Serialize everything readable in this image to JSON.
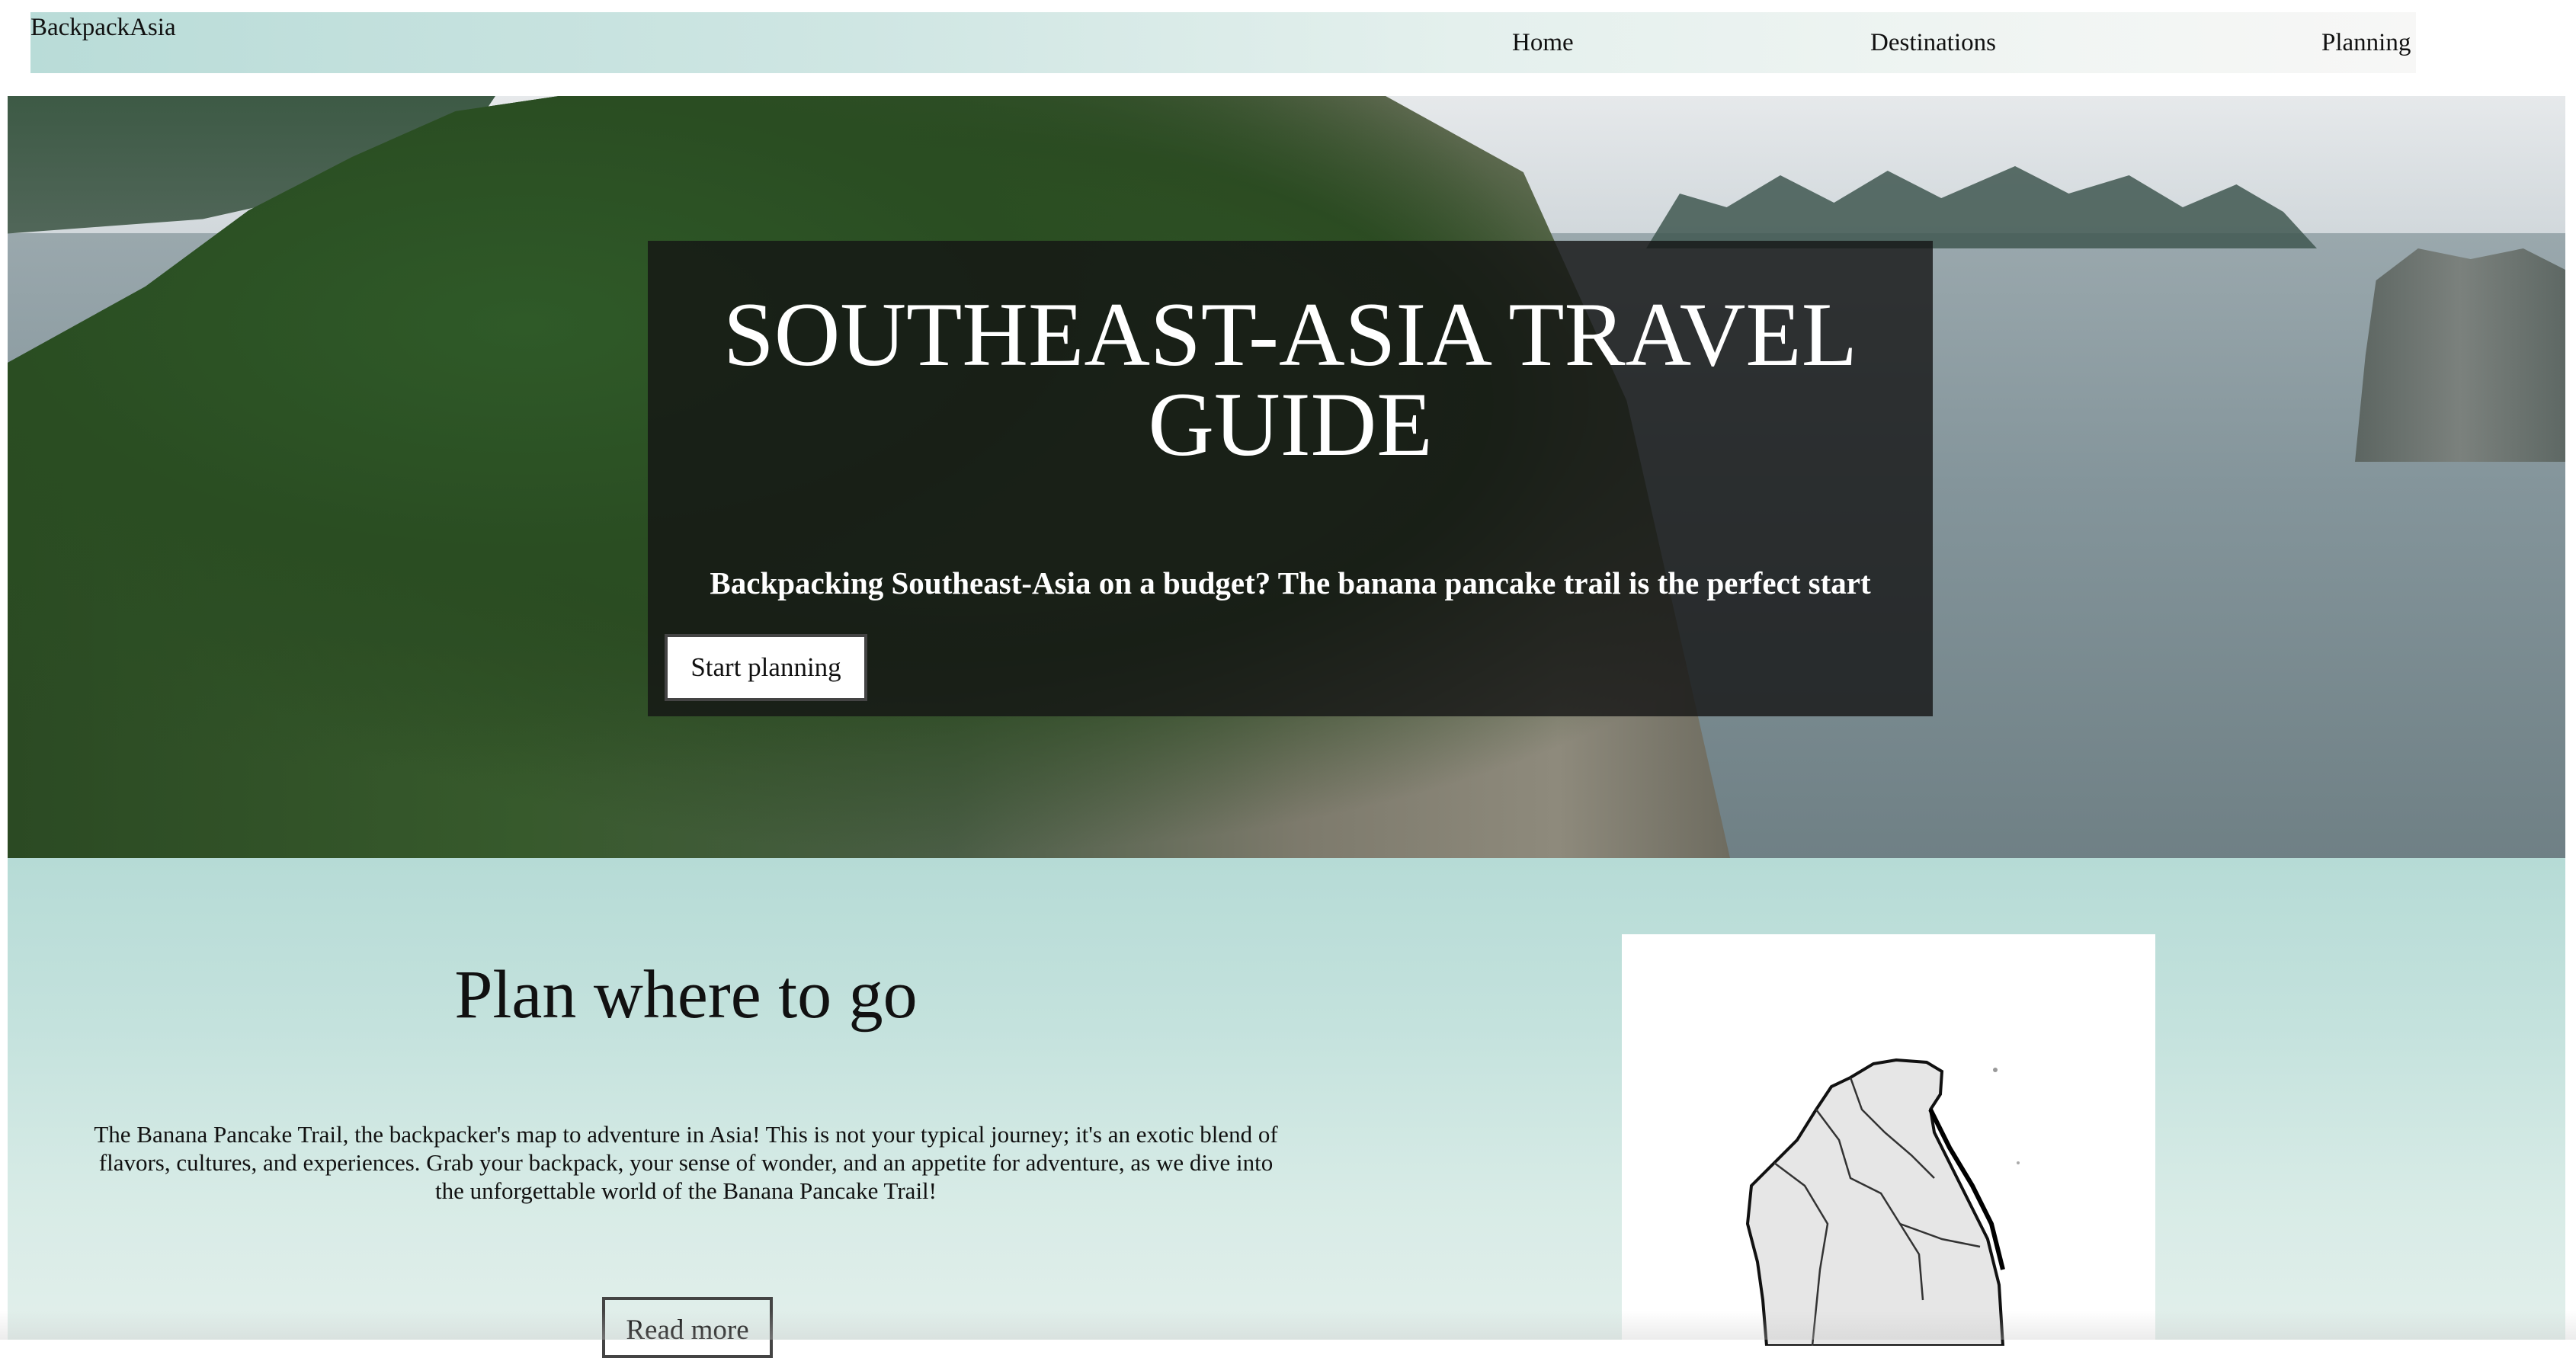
{
  "nav": {
    "brand": "BackpackAsia",
    "links": [
      "Home",
      "Destinations",
      "Planning"
    ]
  },
  "hero": {
    "title": "SOUTHEAST-ASIA TRAVEL GUIDE",
    "subtitle": "Backpacking Southeast-Asia on a budget? The banana pancake trail is the perfect start",
    "button_label": "Start planning",
    "background_image": "aerial-karst-islands-bay-photo"
  },
  "plan": {
    "title": "Plan where to go",
    "text": "The Banana Pancake Trail, the backpacker's map to adventure in Asia! This is not your typical journey; it's an exotic blend of flavors, cultures, and experiences. Grab your backpack, your sense of wonder, and an appetite for adventure, as we dive into the unforgettable world of the Banana Pancake Trail!",
    "button_label": "Read more",
    "map_image": "southeast-asia-outline-map"
  },
  "colors": {
    "nav_gradient_start": "#b9dcd8",
    "nav_gradient_end": "#f7f7f6",
    "section_bg": "#c4e2dd",
    "hero_panel": "#141414"
  }
}
